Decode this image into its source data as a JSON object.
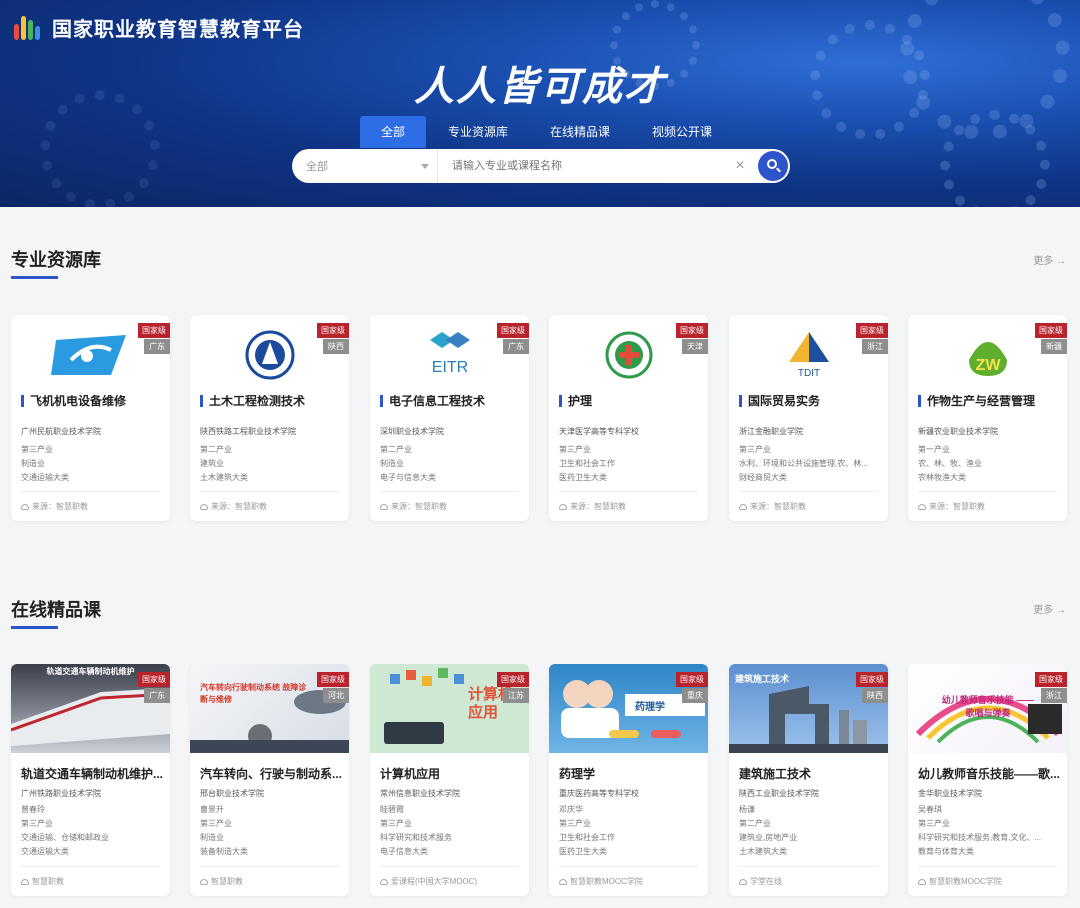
{
  "header": {
    "site_name": "国家职业教育智慧教育平台",
    "slogan": "人人皆可成才",
    "tabs": [
      "全部",
      "专业资源库",
      "在线精品课",
      "视频公开课"
    ],
    "search": {
      "scope": "全部",
      "placeholder": "请输入专业或课程名称"
    }
  },
  "resources": {
    "title": "专业资源库",
    "more": "更多 →",
    "cards": [
      {
        "title": "飞机机电设备维修",
        "level": "国家级",
        "region": "广东",
        "school": "广州民航职业技术学院",
        "meta": [
          "第三产业",
          "制造业",
          "交通运输大类"
        ],
        "source": "来源：智慧职教",
        "logo": "plane-logo"
      },
      {
        "title": "土木工程检测技术",
        "level": "国家级",
        "region": "陕西",
        "school": "陕西铁路工程职业技术学院",
        "meta": [
          "第二产业",
          "建筑业",
          "土木建筑大类"
        ],
        "source": "来源：智慧职教",
        "logo": "railway-logo"
      },
      {
        "title": "电子信息工程技术",
        "level": "国家级",
        "region": "广东",
        "school": "深圳职业技术学院",
        "meta": [
          "第二产业",
          "制造业",
          "电子与信息大类"
        ],
        "source": "来源：智慧职教",
        "logo": "eitr-logo",
        "logo_text": "EITR"
      },
      {
        "title": "护理",
        "level": "国家级",
        "region": "天津",
        "school": "天津医学高等专科学校",
        "meta": [
          "第三产业",
          "卫生和社会工作",
          "医药卫生大类"
        ],
        "source": "来源：智慧职教",
        "logo": "nursing-logo"
      },
      {
        "title": "国际贸易实务",
        "level": "国家级",
        "region": "浙江",
        "school": "浙江金融职业学院",
        "meta": [
          "第三产业",
          "水利、环境和公共设施管理,农、林...",
          "财经商贸大类"
        ],
        "source": "来源：智慧职教",
        "logo": "tdit-logo",
        "logo_text": "TDIT"
      },
      {
        "title": "作物生产与经营管理",
        "level": "国家级",
        "region": "新疆",
        "school": "新疆农业职业技术学院",
        "meta": [
          "第一产业",
          "农、林、牧、渔业",
          "农林牧渔大类"
        ],
        "source": "来源：智慧职教",
        "logo": "zw-logo",
        "logo_text": "ZW"
      }
    ]
  },
  "courses": {
    "title": "在线精品课",
    "more": "更多 →",
    "cards": [
      {
        "title": "轨道交通车辆制动机维护...",
        "level": "国家级",
        "region": "广东",
        "school": "广州铁路职业技术学院",
        "meta": [
          "曾春玲",
          "第三产业",
          "交通运输、仓储和邮政业",
          "交通运输大类"
        ],
        "source": "智慧职教",
        "thumb_text": "轨道交通车辆制动机维护"
      },
      {
        "title": "汽车转向、行驶与制动系...",
        "level": "国家级",
        "region": "河北",
        "school": "邢台职业技术学院",
        "meta": [
          "曹景升",
          "第三产业",
          "制造业",
          "装备制造大类"
        ],
        "source": "智慧职教",
        "thumb_text": "汽车转向行驶制动系统 故障诊断与维修"
      },
      {
        "title": "计算机应用",
        "level": "国家级",
        "region": "江苏",
        "school": "常州信息职业技术学院",
        "meta": [
          "眭碧霞",
          "第三产业",
          "科学研究和技术服务",
          "电子信息大类"
        ],
        "source": "爱课程(中国大学MOOC)",
        "thumb_text": "计算机 应用"
      },
      {
        "title": "药理学",
        "level": "国家级",
        "region": "重庆",
        "school": "重庆医药高等专科学校",
        "meta": [
          "邓庆华",
          "第三产业",
          "卫生和社会工作",
          "医药卫生大类"
        ],
        "source": "智慧职教MOOC学院",
        "thumb_text": "药理学"
      },
      {
        "title": "建筑施工技术",
        "level": "国家级",
        "region": "陕西",
        "school": "陕西工业职业技术学院",
        "meta": [
          "杨谦",
          "第二产业",
          "建筑业,房地产业",
          "土木建筑大类"
        ],
        "source": "学堂在线",
        "thumb_text": "建筑施工技术"
      },
      {
        "title": "幼儿教师音乐技能——歌...",
        "level": "国家级",
        "region": "浙江",
        "school": "金华职业技术学院",
        "meta": [
          "吴春琪",
          "第三产业",
          "科学研究和技术服务,教育,文化、...",
          "教育与体育大类"
        ],
        "source": "智慧职教MOOC学院",
        "thumb_text": "幼儿教师音乐技能 ——歌唱与弹奏"
      }
    ]
  },
  "colors": {
    "accent": "#2d54c9",
    "badge_level": "#b8232c",
    "badge_region": "#8e8e8e",
    "banner": "#0f3485"
  }
}
